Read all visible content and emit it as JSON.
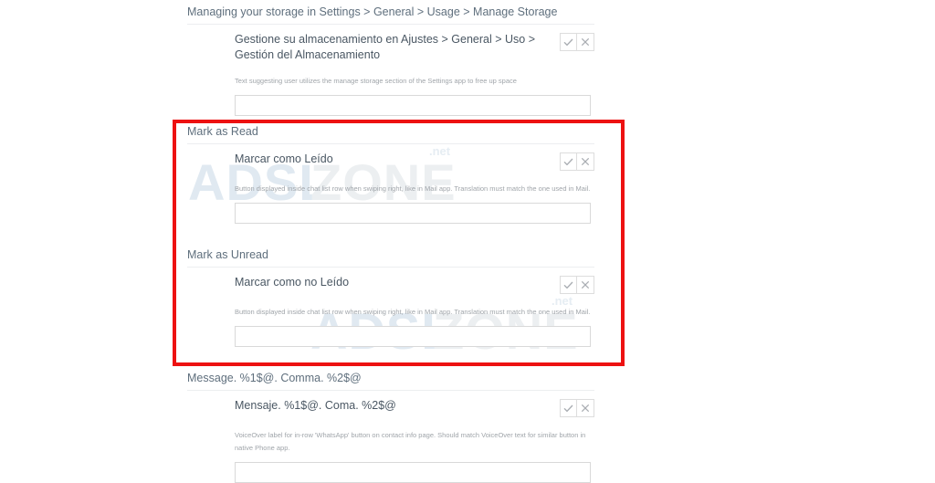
{
  "watermarks": [
    {
      "adsl": "ADSL",
      "zone": "ZONE",
      "net": ".net"
    },
    {
      "adsl": "ADSL",
      "zone": "ZONE",
      "net": ".net"
    }
  ],
  "buttons": {
    "approve_icon": "check-icon",
    "reject_icon": "close-icon",
    "approve_label": "Approve translation",
    "reject_label": "Reject translation"
  },
  "accent": {
    "highlight_border": "#ed1111",
    "section_title": "#5f6f7d",
    "description": "#a0a5aa",
    "watermark_adsl": "#e0e9f1",
    "watermark_zone": "#eceff1"
  },
  "sections": [
    {
      "title": "Managing your storage in Settings > General > Usage > Manage Storage",
      "translation": "Gestione su almacenamiento en Ajustes > General > Uso > Gestión del Almacenamiento",
      "description": "Text suggesting user utilizes the manage storage section of the Settings app to free up space",
      "input_value": "",
      "input_placeholder": ""
    },
    {
      "title": "Mark as Read",
      "translation": "Marcar como Leído",
      "description": "Button displayed inside chat list row when swiping right, like in Mail app. Translation must match the one used in Mail.",
      "input_value": "",
      "input_placeholder": ""
    },
    {
      "title": "Mark as Unread",
      "translation": "Marcar como no Leído",
      "description": "Button displayed inside chat list row when swiping right, like in Mail app. Translation must match the one used in Mail.",
      "input_value": "",
      "input_placeholder": ""
    },
    {
      "title": "Message. %1$@. Comma. %2$@",
      "translation": "Mensaje. %1$@. Coma. %2$@",
      "description": "VoiceOver label for in-row 'WhatsApp' button on contact info page. Should match VoiceOver text for similar button in native Phone app.",
      "input_value": "",
      "input_placeholder": ""
    }
  ]
}
